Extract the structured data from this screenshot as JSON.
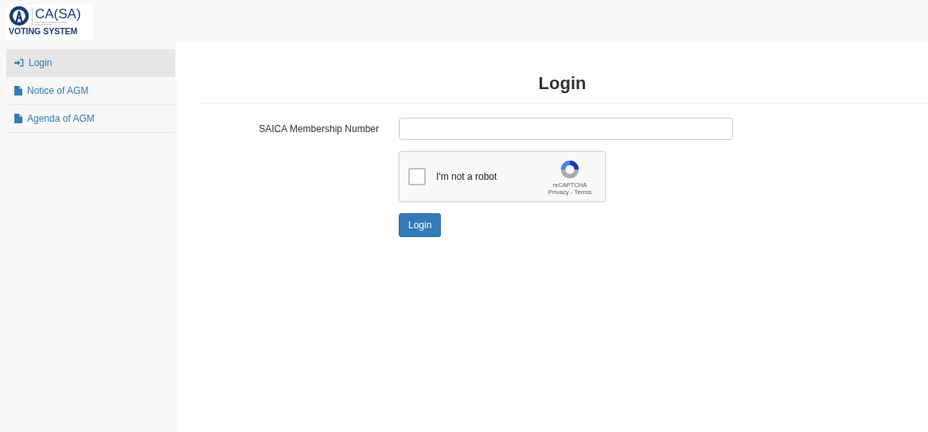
{
  "logo": {
    "name": "CA(SA)",
    "subtitle": "VOTING SYSTEM"
  },
  "sidebar": {
    "items": [
      {
        "label": "Login",
        "kind": "signin",
        "selected": true
      },
      {
        "label": "Notice of AGM",
        "kind": "file",
        "selected": false
      },
      {
        "label": "Agenda of AGM",
        "kind": "file",
        "selected": false
      }
    ]
  },
  "page": {
    "title": "Login",
    "field": {
      "label": "SAICA Membership Number"
    },
    "captcha": {
      "checked": false,
      "label": "I'm not a robot",
      "brand": "reCAPTCHA",
      "privacy": "Privacy",
      "separator": "-",
      "terms": "Terms"
    },
    "button": "Login"
  }
}
